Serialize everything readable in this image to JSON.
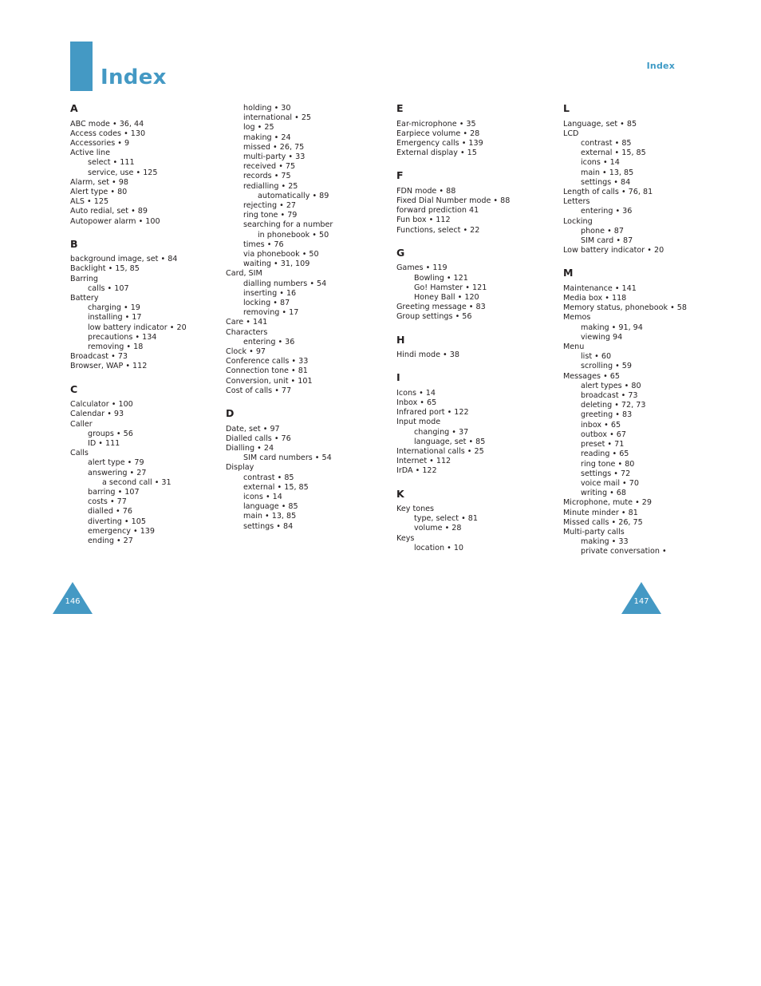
{
  "header": {
    "running_head": "Index",
    "title": "Index"
  },
  "colors": {
    "accent": "#4499c4",
    "text": "#231f20",
    "page_background": "#ffffff"
  },
  "page_numbers": {
    "left": "146",
    "right": "147"
  },
  "columns": [
    {
      "id": "column-1",
      "groups": [
        {
          "letter": "A",
          "entries": [
            {
              "level": 0,
              "text": "ABC mode • 36, 44"
            },
            {
              "level": 0,
              "text": "Access codes • 130"
            },
            {
              "level": 0,
              "text": "Accessories • 9"
            },
            {
              "level": 0,
              "text": "Active line"
            },
            {
              "level": 1,
              "text": "select • 111"
            },
            {
              "level": 1,
              "text": "service, use • 125"
            },
            {
              "level": 0,
              "text": "Alarm, set • 98"
            },
            {
              "level": 0,
              "text": "Alert type • 80"
            },
            {
              "level": 0,
              "text": "ALS • 125"
            },
            {
              "level": 0,
              "text": "Auto redial, set • 89"
            },
            {
              "level": 0,
              "text": "Autopower alarm • 100"
            }
          ]
        },
        {
          "letter": "B",
          "entries": [
            {
              "level": 0,
              "text": "background image, set • 84"
            },
            {
              "level": 0,
              "text": "Backlight • 15, 85"
            },
            {
              "level": 0,
              "text": "Barring"
            },
            {
              "level": 1,
              "text": "calls • 107"
            },
            {
              "level": 0,
              "text": "Battery"
            },
            {
              "level": 1,
              "text": "charging • 19"
            },
            {
              "level": 1,
              "text": "installing • 17"
            },
            {
              "level": 1,
              "wrap": true,
              "text": "low battery indicator • 20"
            },
            {
              "level": 1,
              "text": "precautions • 134"
            },
            {
              "level": 1,
              "text": "removing • 18"
            },
            {
              "level": 0,
              "text": "Broadcast • 73"
            },
            {
              "level": 0,
              "text": "Browser, WAP • 112"
            }
          ]
        },
        {
          "letter": "C",
          "entries": [
            {
              "level": 0,
              "text": "Calculator • 100"
            },
            {
              "level": 0,
              "text": "Calendar • 93"
            },
            {
              "level": 0,
              "text": "Caller"
            },
            {
              "level": 1,
              "text": "groups • 56"
            },
            {
              "level": 1,
              "text": "ID • 111"
            },
            {
              "level": 0,
              "text": "Calls"
            },
            {
              "level": 1,
              "text": "alert type • 79"
            },
            {
              "level": 1,
              "text": "answering • 27"
            },
            {
              "level": 2,
              "text": "a second call • 31"
            },
            {
              "level": 1,
              "text": "barring • 107"
            },
            {
              "level": 1,
              "text": "costs • 77"
            },
            {
              "level": 1,
              "text": "dialled • 76"
            },
            {
              "level": 1,
              "text": "diverting • 105"
            },
            {
              "level": 1,
              "text": "emergency • 139"
            },
            {
              "level": 1,
              "text": "ending • 27"
            }
          ]
        }
      ]
    },
    {
      "id": "column-2",
      "groups": [
        {
          "letter": "",
          "entries": [
            {
              "level": 1,
              "text": "holding • 30"
            },
            {
              "level": 1,
              "text": "international • 25"
            },
            {
              "level": 1,
              "text": "log • 25"
            },
            {
              "level": 1,
              "text": "making • 24"
            },
            {
              "level": 1,
              "text": "missed • 26, 75"
            },
            {
              "level": 1,
              "text": "multi-party • 33"
            },
            {
              "level": 1,
              "text": "received • 75"
            },
            {
              "level": 1,
              "text": "records • 75"
            },
            {
              "level": 1,
              "text": "redialling • 25"
            },
            {
              "level": 2,
              "text": "automatically • 89"
            },
            {
              "level": 1,
              "text": "rejecting • 27"
            },
            {
              "level": 1,
              "text": "ring tone • 79"
            },
            {
              "level": 1,
              "text": "searching for a number"
            },
            {
              "level": 2,
              "text": "in phonebook • 50"
            },
            {
              "level": 1,
              "text": "times • 76"
            },
            {
              "level": 1,
              "text": "via phonebook • 50"
            },
            {
              "level": 1,
              "text": "waiting • 31, 109"
            },
            {
              "level": 0,
              "text": "Card, SIM"
            },
            {
              "level": 1,
              "text": "dialling numbers • 54"
            },
            {
              "level": 1,
              "text": "inserting • 16"
            },
            {
              "level": 1,
              "text": "locking • 87"
            },
            {
              "level": 1,
              "text": "removing • 17"
            },
            {
              "level": 0,
              "text": "Care • 141"
            },
            {
              "level": 0,
              "text": "Characters"
            },
            {
              "level": 1,
              "text": "entering • 36"
            },
            {
              "level": 0,
              "text": "Clock • 97"
            },
            {
              "level": 0,
              "text": "Conference calls • 33"
            },
            {
              "level": 0,
              "text": "Connection tone • 81"
            },
            {
              "level": 0,
              "text": "Conversion, unit • 101"
            },
            {
              "level": 0,
              "text": "Cost of calls • 77"
            }
          ]
        },
        {
          "letter": "D",
          "entries": [
            {
              "level": 0,
              "text": "Date, set • 97"
            },
            {
              "level": 0,
              "text": "Dialled calls • 76"
            },
            {
              "level": 0,
              "text": "Dialling • 24"
            },
            {
              "level": 1,
              "text": "SIM card numbers • 54"
            },
            {
              "level": 0,
              "text": "Display"
            },
            {
              "level": 1,
              "text": "contrast • 85"
            },
            {
              "level": 1,
              "text": "external • 15, 85"
            },
            {
              "level": 1,
              "text": "icons • 14"
            },
            {
              "level": 1,
              "text": "language • 85"
            },
            {
              "level": 1,
              "text": "main • 13, 85"
            },
            {
              "level": 1,
              "text": "settings • 84"
            }
          ]
        }
      ]
    },
    {
      "id": "column-3",
      "groups": [
        {
          "letter": "E",
          "entries": [
            {
              "level": 0,
              "text": "Ear-microphone • 35"
            },
            {
              "level": 0,
              "text": "Earpiece volume • 28"
            },
            {
              "level": 0,
              "text": "Emergency calls • 139"
            },
            {
              "level": 0,
              "text": "External display • 15"
            }
          ]
        },
        {
          "letter": "F",
          "entries": [
            {
              "level": 0,
              "text": "FDN mode • 88"
            },
            {
              "level": 0,
              "text": "Fixed Dial Number mode • 88"
            },
            {
              "level": 0,
              "text": "forward prediction 41"
            },
            {
              "level": 0,
              "text": "Fun box • 112"
            },
            {
              "level": 0,
              "text": "Functions, select • 22"
            }
          ]
        },
        {
          "letter": "G",
          "entries": [
            {
              "level": 0,
              "text": "Games • 119"
            },
            {
              "level": 1,
              "text": "Bowling • 121"
            },
            {
              "level": 1,
              "text": "Go! Hamster • 121"
            },
            {
              "level": 1,
              "text": "Honey Ball • 120"
            },
            {
              "level": 0,
              "text": "Greeting message • 83"
            },
            {
              "level": 0,
              "text": "Group settings • 56"
            }
          ]
        },
        {
          "letter": "H",
          "entries": [
            {
              "level": 0,
              "text": "Hindi mode • 38"
            }
          ]
        },
        {
          "letter": "I",
          "entries": [
            {
              "level": 0,
              "text": "Icons • 14"
            },
            {
              "level": 0,
              "text": "Inbox • 65"
            },
            {
              "level": 0,
              "text": "Infrared port • 122"
            },
            {
              "level": 0,
              "text": "Input mode"
            },
            {
              "level": 1,
              "text": "changing • 37"
            },
            {
              "level": 1,
              "text": "language, set • 85"
            },
            {
              "level": 0,
              "text": "International calls • 25"
            },
            {
              "level": 0,
              "text": "Internet • 112"
            },
            {
              "level": 0,
              "text": "IrDA • 122"
            }
          ]
        },
        {
          "letter": "K",
          "entries": [
            {
              "level": 0,
              "text": "Key tones"
            },
            {
              "level": 1,
              "text": "type, select • 81"
            },
            {
              "level": 1,
              "text": "volume • 28"
            },
            {
              "level": 0,
              "text": "Keys"
            },
            {
              "level": 1,
              "text": "location • 10"
            }
          ]
        }
      ]
    },
    {
      "id": "column-4",
      "groups": [
        {
          "letter": "L",
          "entries": [
            {
              "level": 0,
              "text": "Language, set • 85"
            },
            {
              "level": 0,
              "text": "LCD"
            },
            {
              "level": 1,
              "text": "contrast • 85"
            },
            {
              "level": 1,
              "text": "external • 15, 85"
            },
            {
              "level": 1,
              "text": "icons • 14"
            },
            {
              "level": 1,
              "text": "main • 13, 85"
            },
            {
              "level": 1,
              "text": "settings • 84"
            },
            {
              "level": 0,
              "text": "Length of calls • 76, 81"
            },
            {
              "level": 0,
              "text": "Letters"
            },
            {
              "level": 1,
              "text": "entering • 36"
            },
            {
              "level": 0,
              "text": "Locking"
            },
            {
              "level": 1,
              "text": "phone • 87"
            },
            {
              "level": 1,
              "text": "SIM card • 87"
            },
            {
              "level": 0,
              "text": "Low battery indicator • 20"
            }
          ]
        },
        {
          "letter": "M",
          "entries": [
            {
              "level": 0,
              "text": "Maintenance • 141"
            },
            {
              "level": 0,
              "text": "Media box • 118"
            },
            {
              "level": 0,
              "wrap": true,
              "text": "Memory status, phonebook • 58"
            },
            {
              "level": 0,
              "text": "Memos"
            },
            {
              "level": 1,
              "text": "making • 91, 94"
            },
            {
              "level": 1,
              "text": "viewing 94"
            },
            {
              "level": 0,
              "text": "Menu"
            },
            {
              "level": 1,
              "text": "list • 60"
            },
            {
              "level": 1,
              "text": "scrolling • 59"
            },
            {
              "level": 0,
              "text": "Messages • 65"
            },
            {
              "level": 1,
              "text": "alert types • 80"
            },
            {
              "level": 1,
              "text": "broadcast • 73"
            },
            {
              "level": 1,
              "text": "deleting • 72, 73"
            },
            {
              "level": 1,
              "text": "greeting • 83"
            },
            {
              "level": 1,
              "text": "inbox • 65"
            },
            {
              "level": 1,
              "text": "outbox • 67"
            },
            {
              "level": 1,
              "text": "preset • 71"
            },
            {
              "level": 1,
              "text": "reading • 65"
            },
            {
              "level": 1,
              "text": "ring tone • 80"
            },
            {
              "level": 1,
              "text": "settings • 72"
            },
            {
              "level": 1,
              "text": "voice mail • 70"
            },
            {
              "level": 1,
              "text": "writing • 68"
            },
            {
              "level": 0,
              "text": "Microphone, mute • 29"
            },
            {
              "level": 0,
              "text": "Minute minder • 81"
            },
            {
              "level": 0,
              "text": "Missed calls • 26, 75"
            },
            {
              "level": 0,
              "text": "Multi-party calls"
            },
            {
              "level": 1,
              "text": "making • 33"
            },
            {
              "level": 1,
              "text": "private conversation •"
            }
          ]
        }
      ]
    }
  ]
}
